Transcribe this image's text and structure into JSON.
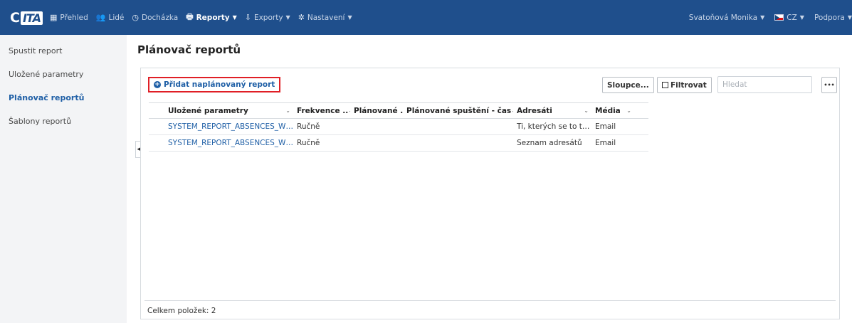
{
  "navbar": {
    "logo_c": "C",
    "logo_ita": "ITA",
    "items": [
      {
        "label": "Přehled",
        "icon": "grid-icon"
      },
      {
        "label": "Lidé",
        "icon": "users-icon"
      },
      {
        "label": "Docházka",
        "icon": "clock-icon"
      },
      {
        "label": "Reporty",
        "icon": "print-icon"
      },
      {
        "label": "Exporty",
        "icon": "export-icon"
      },
      {
        "label": "Nastavení",
        "icon": "gear-icon"
      }
    ],
    "user": "Svatoňová Monika",
    "language": "CZ",
    "support": "Podpora"
  },
  "sidebar": {
    "items": [
      {
        "label": "Spustit report"
      },
      {
        "label": "Uložené parametry"
      },
      {
        "label": "Plánovač reportů"
      },
      {
        "label": "Šablony reportů"
      }
    ]
  },
  "page": {
    "title": "Plánovač reportů",
    "add_label": "Přidat naplánovaný report",
    "columns_button": "Sloupce...",
    "filter_button": "Filtrovat",
    "search_placeholder": "Hledat",
    "more_button": "•••"
  },
  "table": {
    "headers": [
      "Uložené parametry",
      "Frekvence ..",
      "Plánované ..",
      "Plánované spuštění - čas",
      "Adresáti",
      "Média"
    ],
    "rows": [
      [
        "SYSTEM_REPORT_ABSENCES_WIDGET...",
        "Ručně",
        "",
        "",
        "Ti, kterých se to týká",
        "Email"
      ],
      [
        "SYSTEM_REPORT_ABSENCES_WIDGET...",
        "Ručně",
        "",
        "",
        "Seznam adresátů",
        "Email"
      ]
    ]
  },
  "footer": {
    "total": "Celkem položek: 2"
  },
  "colors": {
    "navbar": "#1f4f8c",
    "accent": "#1f5fa6",
    "highlight_border": "#e01f26"
  }
}
